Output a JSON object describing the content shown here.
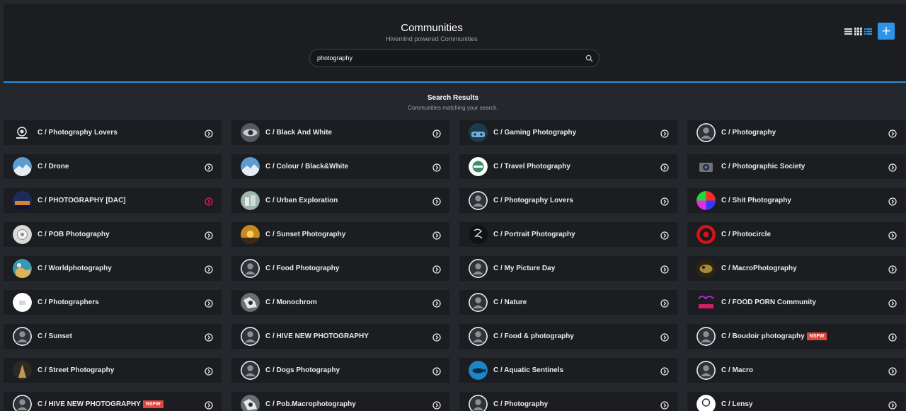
{
  "header": {
    "title": "Communities",
    "subtitle": "Hivemind powered Communities",
    "add_label": "+",
    "view_icons": [
      "list-view-icon",
      "grid-view-icon",
      "compact-list-icon"
    ]
  },
  "search": {
    "value": "photography",
    "placeholder": ""
  },
  "results": {
    "title": "Search Results",
    "subtitle": "Communities matching your search."
  },
  "colors": {
    "accent": "#2b95e9",
    "nsfw": "#e5433b",
    "card": "#1b1d21",
    "bg": "#24272c",
    "highlight_arrow": "#e0245e"
  },
  "communities": [
    {
      "name": "C / Photography Lovers",
      "avatar": "photo-lovers",
      "nsfw": false
    },
    {
      "name": "C / Black And White",
      "avatar": "grey-eye",
      "nsfw": false
    },
    {
      "name": "C / Gaming Photography",
      "avatar": "gaming",
      "nsfw": false
    },
    {
      "name": "C / Photography",
      "avatar": "default",
      "nsfw": false
    },
    {
      "name": "C / Drone",
      "avatar": "sky",
      "nsfw": false
    },
    {
      "name": "C / Colour / Black&White",
      "avatar": "sky",
      "nsfw": false
    },
    {
      "name": "C / Travel Photography",
      "avatar": "travel",
      "nsfw": false
    },
    {
      "name": "C / Photographic Society",
      "avatar": "camera",
      "nsfw": false
    },
    {
      "name": "C / PHOTOGRAPHY [DAC]",
      "avatar": "night-city",
      "nsfw": false,
      "highlight": true
    },
    {
      "name": "C / Urban Exploration",
      "avatar": "urban",
      "nsfw": false
    },
    {
      "name": "C / Photography Lovers",
      "avatar": "default",
      "nsfw": false
    },
    {
      "name": "C / Shit Photography",
      "avatar": "color-wheel",
      "nsfw": false
    },
    {
      "name": "C / POB Photography",
      "avatar": "pob",
      "nsfw": false
    },
    {
      "name": "C / Sunset Photography",
      "avatar": "sunset",
      "nsfw": false
    },
    {
      "name": "C / Portrait Photography",
      "avatar": "portrait",
      "nsfw": false
    },
    {
      "name": "C / Photocircle",
      "avatar": "aperture",
      "nsfw": false
    },
    {
      "name": "C / Worldphotography",
      "avatar": "world",
      "nsfw": false
    },
    {
      "name": "C / Food Photography",
      "avatar": "default",
      "nsfw": false
    },
    {
      "name": "C / My Picture Day",
      "avatar": "default",
      "nsfw": false
    },
    {
      "name": "C / MacroPhotography",
      "avatar": "macro",
      "nsfw": false
    },
    {
      "name": "C / Photographers",
      "avatar": "white",
      "nsfw": false
    },
    {
      "name": "C / Monochrom",
      "avatar": "mono",
      "nsfw": false
    },
    {
      "name": "C / Nature",
      "avatar": "default",
      "nsfw": false
    },
    {
      "name": "C / FOOD PORN Community",
      "avatar": "foodporn",
      "nsfw": false
    },
    {
      "name": "C / Sunset",
      "avatar": "default",
      "nsfw": false
    },
    {
      "name": "C / HIVE NEW PHOTOGRAPHY",
      "avatar": "default",
      "nsfw": false
    },
    {
      "name": "C / Food & photography",
      "avatar": "default",
      "nsfw": false
    },
    {
      "name": "C / Boudoir photography",
      "avatar": "default",
      "nsfw": true,
      "nsfw_label": "NSFW"
    },
    {
      "name": "C / Street Photography",
      "avatar": "street",
      "nsfw": false
    },
    {
      "name": "C / Dogs Photography",
      "avatar": "default",
      "nsfw": false
    },
    {
      "name": "C / Aquatic Sentinels",
      "avatar": "aquatic",
      "nsfw": false
    },
    {
      "name": "C / Macro",
      "avatar": "default",
      "nsfw": false
    },
    {
      "name": "C / HIVE NEW PHOTOGRAPHY",
      "avatar": "default",
      "nsfw": true,
      "nsfw_label": "NSFW"
    },
    {
      "name": "C / Pob.Macrophotography",
      "avatar": "mono",
      "nsfw": false
    },
    {
      "name": "C / Photography",
      "avatar": "default",
      "nsfw": false
    },
    {
      "name": "C / Lensy",
      "avatar": "lensy",
      "nsfw": false,
      "avatar_text": "LENSY"
    }
  ]
}
